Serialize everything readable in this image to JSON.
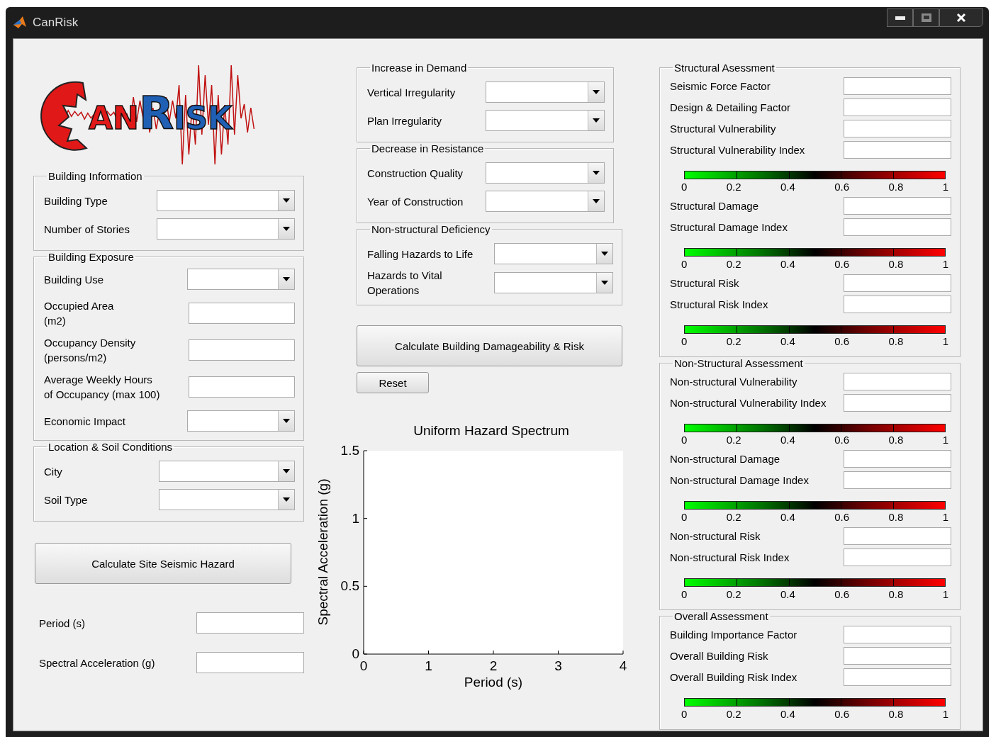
{
  "window": {
    "title": "CanRisk"
  },
  "logo": {
    "parts": [
      {
        "text": "AN",
        "color": "#e01818"
      },
      {
        "text": "R",
        "color": "#1f5fb4"
      },
      {
        "text": "ISK",
        "color": "#1f5fb4"
      }
    ]
  },
  "left": {
    "groups": [
      {
        "title": "Building Information",
        "rows": [
          {
            "label": "Building Type",
            "kind": "dropdown"
          },
          {
            "label": "Number of Stories",
            "kind": "dropdown"
          }
        ]
      },
      {
        "title": "Building Exposure",
        "rows": [
          {
            "label": "Building Use",
            "kind": "dropdown"
          },
          {
            "label": "Occupied Area\n(m2)",
            "kind": "text"
          },
          {
            "label": "Occupancy Density\n(persons/m2)",
            "kind": "text"
          },
          {
            "label": "Average Weekly Hours\nof Occupancy (max 100)",
            "kind": "text"
          },
          {
            "label": "Economic Impact",
            "kind": "dropdown"
          }
        ]
      },
      {
        "title": "Location & Soil Conditions",
        "rows": [
          {
            "label": "City",
            "kind": "dropdown"
          },
          {
            "label": "Soil Type",
            "kind": "dropdown"
          }
        ]
      }
    ],
    "button": "Calculate Site Seismic Hazard",
    "outputs": [
      {
        "label": "Period (s)",
        "kind": "text"
      },
      {
        "label": "Spectral Acceleration (g)",
        "kind": "text"
      }
    ]
  },
  "middle": {
    "groups": [
      {
        "title": "Increase in Demand",
        "rows": [
          {
            "label": "Vertical Irregularity",
            "kind": "dropdown"
          },
          {
            "label": "Plan Irregularity",
            "kind": "dropdown"
          }
        ]
      },
      {
        "title": "Decrease in Resistance",
        "rows": [
          {
            "label": "Construction Quality",
            "kind": "dropdown"
          },
          {
            "label": "Year of Construction",
            "kind": "dropdown"
          }
        ]
      },
      {
        "title": "Non-structural Deficiency",
        "rows": [
          {
            "label": "Falling Hazards to Life",
            "kind": "dropdown"
          },
          {
            "label": "Hazards to Vital\nOperations",
            "kind": "dropdown"
          }
        ]
      }
    ],
    "calculate_button": "Calculate Building Damageability & Risk",
    "reset_button": "Reset",
    "chart_data": {
      "type": "line",
      "title": "Uniform Hazard Spectrum",
      "xlabel": "Period (s)",
      "ylabel": "Spectral Acceleration (g)",
      "xlim": [
        0,
        4
      ],
      "ylim": [
        0,
        1.5
      ],
      "xticks": [
        0,
        1,
        2,
        3,
        4
      ],
      "yticks": [
        0,
        0.5,
        1,
        1.5
      ]
    }
  },
  "right": {
    "groups": [
      {
        "title": "Structural Asessment",
        "rows": [
          {
            "label": "Seismic Force Factor",
            "kind": "text"
          },
          {
            "label": "Design & Detailing Factor",
            "kind": "text"
          },
          {
            "label": "Structural Vulnerability",
            "kind": "text"
          },
          {
            "label": "Structural Vulnerability Index",
            "kind": "text"
          },
          {
            "kind": "colorbar",
            "ticks": [
              "0",
              "0.2",
              "0.4",
              "0.6",
              "0.8",
              "1"
            ]
          },
          {
            "label": "Structural Damage",
            "kind": "text"
          },
          {
            "label": "Structural Damage Index",
            "kind": "text"
          },
          {
            "kind": "colorbar",
            "ticks": [
              "0",
              "0.2",
              "0.4",
              "0.6",
              "0.8",
              "1"
            ]
          },
          {
            "label": "Structural Risk",
            "kind": "text"
          },
          {
            "label": "Structural Risk Index",
            "kind": "text"
          },
          {
            "kind": "colorbar",
            "ticks": [
              "0",
              "0.2",
              "0.4",
              "0.6",
              "0.8",
              "1"
            ]
          }
        ]
      },
      {
        "title": "Non-Structural Assessment",
        "rows": [
          {
            "label": "Non-structural Vulnerability",
            "kind": "text"
          },
          {
            "label": "Non-structural Vulnerability Index",
            "kind": "text"
          },
          {
            "kind": "colorbar",
            "ticks": [
              "0",
              "0.2",
              "0.4",
              "0.6",
              "0.8",
              "1"
            ]
          },
          {
            "label": "Non-structural Damage",
            "kind": "text"
          },
          {
            "label": "Non-structural Damage Index",
            "kind": "text"
          },
          {
            "kind": "colorbar",
            "ticks": [
              "0",
              "0.2",
              "0.4",
              "0.6",
              "0.8",
              "1"
            ]
          },
          {
            "label": "Non-structural Risk",
            "kind": "text"
          },
          {
            "label": "Non-structural Risk Index",
            "kind": "text"
          },
          {
            "kind": "colorbar",
            "ticks": [
              "0",
              "0.2",
              "0.4",
              "0.6",
              "0.8",
              "1"
            ]
          }
        ]
      },
      {
        "title": "Overall Assessment",
        "rows": [
          {
            "label": "Building Importance Factor",
            "kind": "text"
          },
          {
            "label": "Overall Building Risk",
            "kind": "text"
          },
          {
            "label": "Overall Building Risk Index",
            "kind": "text"
          },
          {
            "kind": "colorbar",
            "ticks": [
              "0",
              "0.2",
              "0.4",
              "0.6",
              "0.8",
              "1"
            ]
          }
        ]
      }
    ]
  }
}
